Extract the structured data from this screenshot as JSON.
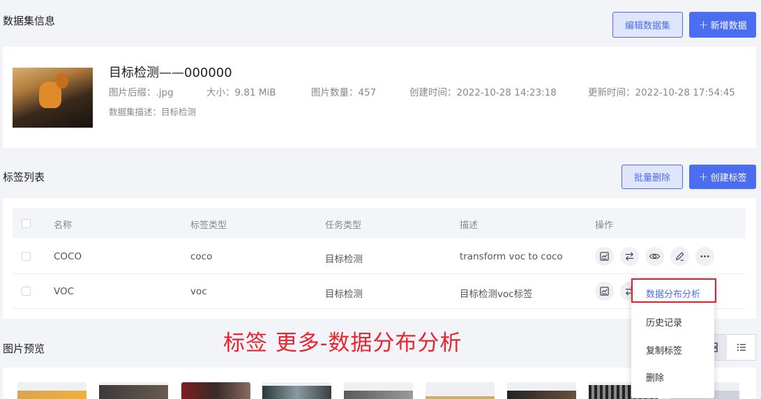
{
  "dataset_section": {
    "title": "数据集信息",
    "edit_button": "编辑数据集",
    "add_button_plus": "+",
    "add_button": "新增数据"
  },
  "dataset": {
    "name": "目标检测——000000",
    "suffix_label": "图片后缀：",
    "suffix_value": ".jpg",
    "size_label": "大小：",
    "size_value": "9.81 MiB",
    "count_label": "图片数量：",
    "count_value": "457",
    "created_label": "创建时间：",
    "created_value": "2022-10-28 14:23:18",
    "updated_label": "更新时间：",
    "updated_value": "2022-10-28 17:54:45",
    "desc_label": "数据集描述：",
    "desc_value": "目标检测"
  },
  "label_section": {
    "title": "标签列表",
    "batch_delete": "批量删除",
    "create_plus": "+",
    "create_button": "创建标签"
  },
  "table": {
    "headers": {
      "name": "名称",
      "label_type": "标签类型",
      "task_type": "任务类型",
      "desc": "描述",
      "ops": "操作"
    },
    "rows": [
      {
        "name": "COCO",
        "label_type": "coco",
        "task_type": "目标检测",
        "desc": "transform voc to coco"
      },
      {
        "name": "VOC",
        "label_type": "voc",
        "task_type": "目标检测",
        "desc": "目标检测voc标签"
      }
    ]
  },
  "dropdown": {
    "items": [
      "数据分布分析",
      "历史记录",
      "复制标签",
      "删除"
    ]
  },
  "annotation": "标签 更多-数据分布分析",
  "preview_section": {
    "title": "图片预览"
  },
  "colors": {
    "primary": "#4b6ef0",
    "annotation_red": "#e8242f",
    "page_bg": "#f3f4f8"
  }
}
